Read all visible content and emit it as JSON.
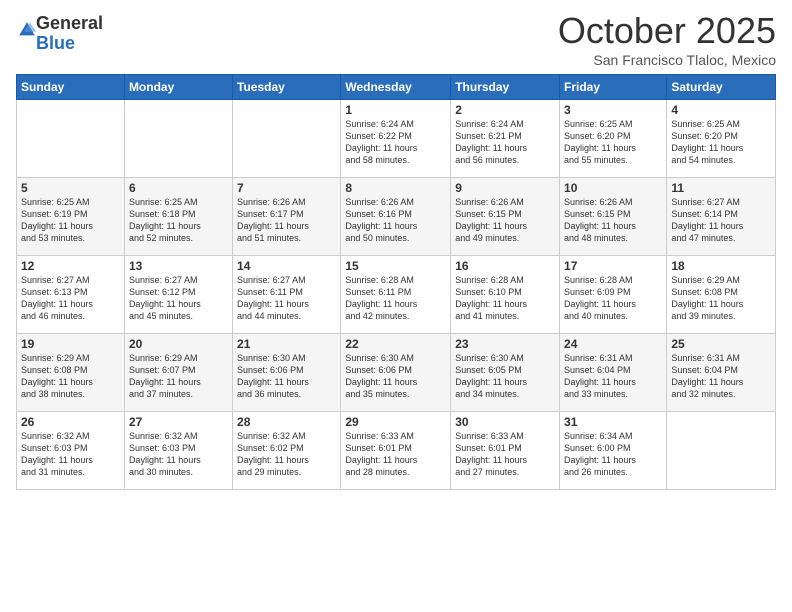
{
  "logo": {
    "general": "General",
    "blue": "Blue"
  },
  "title": "October 2025",
  "location": "San Francisco Tlaloc, Mexico",
  "days_of_week": [
    "Sunday",
    "Monday",
    "Tuesday",
    "Wednesday",
    "Thursday",
    "Friday",
    "Saturday"
  ],
  "weeks": [
    [
      {
        "day": "",
        "info": ""
      },
      {
        "day": "",
        "info": ""
      },
      {
        "day": "",
        "info": ""
      },
      {
        "day": "1",
        "info": "Sunrise: 6:24 AM\nSunset: 6:22 PM\nDaylight: 11 hours\nand 58 minutes."
      },
      {
        "day": "2",
        "info": "Sunrise: 6:24 AM\nSunset: 6:21 PM\nDaylight: 11 hours\nand 56 minutes."
      },
      {
        "day": "3",
        "info": "Sunrise: 6:25 AM\nSunset: 6:20 PM\nDaylight: 11 hours\nand 55 minutes."
      },
      {
        "day": "4",
        "info": "Sunrise: 6:25 AM\nSunset: 6:20 PM\nDaylight: 11 hours\nand 54 minutes."
      }
    ],
    [
      {
        "day": "5",
        "info": "Sunrise: 6:25 AM\nSunset: 6:19 PM\nDaylight: 11 hours\nand 53 minutes."
      },
      {
        "day": "6",
        "info": "Sunrise: 6:25 AM\nSunset: 6:18 PM\nDaylight: 11 hours\nand 52 minutes."
      },
      {
        "day": "7",
        "info": "Sunrise: 6:26 AM\nSunset: 6:17 PM\nDaylight: 11 hours\nand 51 minutes."
      },
      {
        "day": "8",
        "info": "Sunrise: 6:26 AM\nSunset: 6:16 PM\nDaylight: 11 hours\nand 50 minutes."
      },
      {
        "day": "9",
        "info": "Sunrise: 6:26 AM\nSunset: 6:15 PM\nDaylight: 11 hours\nand 49 minutes."
      },
      {
        "day": "10",
        "info": "Sunrise: 6:26 AM\nSunset: 6:15 PM\nDaylight: 11 hours\nand 48 minutes."
      },
      {
        "day": "11",
        "info": "Sunrise: 6:27 AM\nSunset: 6:14 PM\nDaylight: 11 hours\nand 47 minutes."
      }
    ],
    [
      {
        "day": "12",
        "info": "Sunrise: 6:27 AM\nSunset: 6:13 PM\nDaylight: 11 hours\nand 46 minutes."
      },
      {
        "day": "13",
        "info": "Sunrise: 6:27 AM\nSunset: 6:12 PM\nDaylight: 11 hours\nand 45 minutes."
      },
      {
        "day": "14",
        "info": "Sunrise: 6:27 AM\nSunset: 6:11 PM\nDaylight: 11 hours\nand 44 minutes."
      },
      {
        "day": "15",
        "info": "Sunrise: 6:28 AM\nSunset: 6:11 PM\nDaylight: 11 hours\nand 42 minutes."
      },
      {
        "day": "16",
        "info": "Sunrise: 6:28 AM\nSunset: 6:10 PM\nDaylight: 11 hours\nand 41 minutes."
      },
      {
        "day": "17",
        "info": "Sunrise: 6:28 AM\nSunset: 6:09 PM\nDaylight: 11 hours\nand 40 minutes."
      },
      {
        "day": "18",
        "info": "Sunrise: 6:29 AM\nSunset: 6:08 PM\nDaylight: 11 hours\nand 39 minutes."
      }
    ],
    [
      {
        "day": "19",
        "info": "Sunrise: 6:29 AM\nSunset: 6:08 PM\nDaylight: 11 hours\nand 38 minutes."
      },
      {
        "day": "20",
        "info": "Sunrise: 6:29 AM\nSunset: 6:07 PM\nDaylight: 11 hours\nand 37 minutes."
      },
      {
        "day": "21",
        "info": "Sunrise: 6:30 AM\nSunset: 6:06 PM\nDaylight: 11 hours\nand 36 minutes."
      },
      {
        "day": "22",
        "info": "Sunrise: 6:30 AM\nSunset: 6:06 PM\nDaylight: 11 hours\nand 35 minutes."
      },
      {
        "day": "23",
        "info": "Sunrise: 6:30 AM\nSunset: 6:05 PM\nDaylight: 11 hours\nand 34 minutes."
      },
      {
        "day": "24",
        "info": "Sunrise: 6:31 AM\nSunset: 6:04 PM\nDaylight: 11 hours\nand 33 minutes."
      },
      {
        "day": "25",
        "info": "Sunrise: 6:31 AM\nSunset: 6:04 PM\nDaylight: 11 hours\nand 32 minutes."
      }
    ],
    [
      {
        "day": "26",
        "info": "Sunrise: 6:32 AM\nSunset: 6:03 PM\nDaylight: 11 hours\nand 31 minutes."
      },
      {
        "day": "27",
        "info": "Sunrise: 6:32 AM\nSunset: 6:03 PM\nDaylight: 11 hours\nand 30 minutes."
      },
      {
        "day": "28",
        "info": "Sunrise: 6:32 AM\nSunset: 6:02 PM\nDaylight: 11 hours\nand 29 minutes."
      },
      {
        "day": "29",
        "info": "Sunrise: 6:33 AM\nSunset: 6:01 PM\nDaylight: 11 hours\nand 28 minutes."
      },
      {
        "day": "30",
        "info": "Sunrise: 6:33 AM\nSunset: 6:01 PM\nDaylight: 11 hours\nand 27 minutes."
      },
      {
        "day": "31",
        "info": "Sunrise: 6:34 AM\nSunset: 6:00 PM\nDaylight: 11 hours\nand 26 minutes."
      },
      {
        "day": "",
        "info": ""
      }
    ]
  ]
}
